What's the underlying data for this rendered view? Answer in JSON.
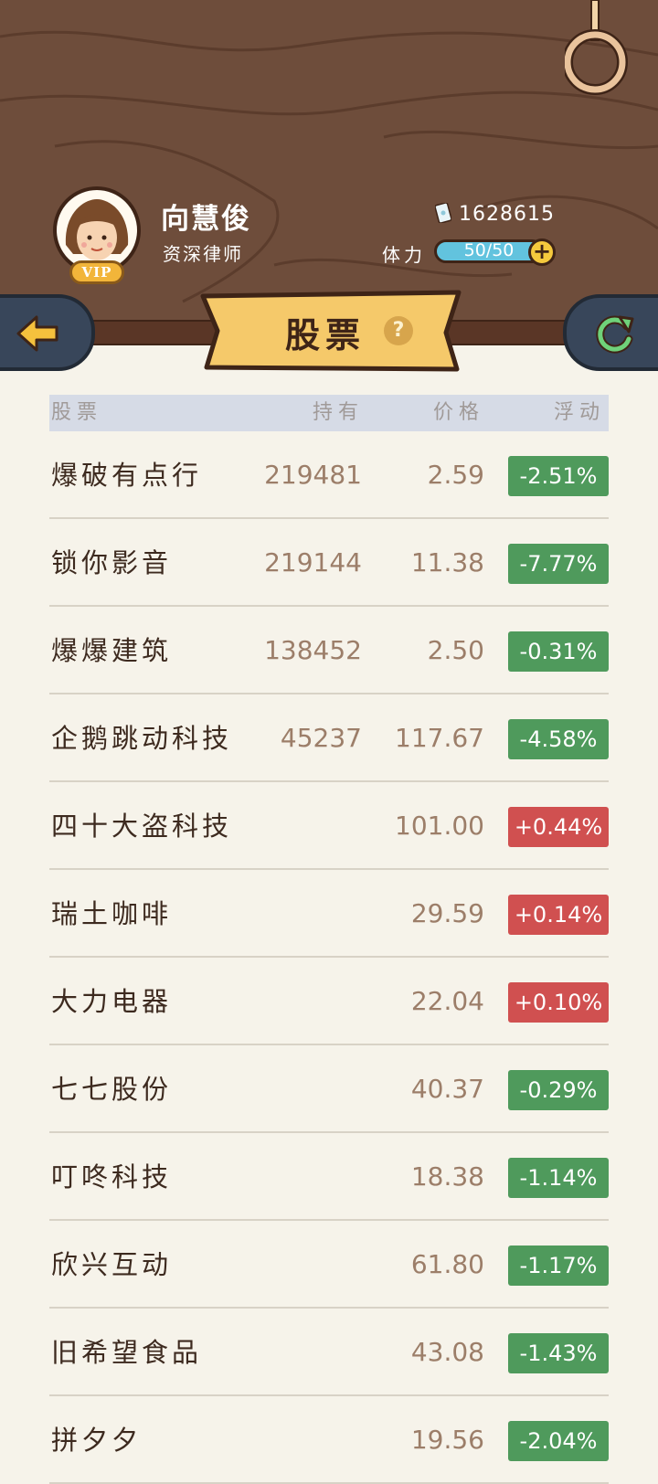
{
  "player": {
    "name": "向慧俊",
    "title": "资深律师",
    "vip": "VIP",
    "money": "1628615",
    "stamina_label": "体力",
    "stamina": "50/50",
    "stamina_fraction": 1.0
  },
  "page": {
    "title": "股票"
  },
  "table": {
    "headers": {
      "stock": "股票",
      "hold": "持有",
      "price": "价格",
      "change": "浮动"
    },
    "rows": [
      {
        "name": "爆破有点行",
        "hold": "219481",
        "price": "2.59",
        "change": "-2.51%",
        "dir": "down"
      },
      {
        "name": "锁你影音",
        "hold": "219144",
        "price": "11.38",
        "change": "-7.77%",
        "dir": "down"
      },
      {
        "name": "爆爆建筑",
        "hold": "138452",
        "price": "2.50",
        "change": "-0.31%",
        "dir": "down"
      },
      {
        "name": "企鹅跳动科技",
        "hold": "45237",
        "price": "117.67",
        "change": "-4.58%",
        "dir": "down"
      },
      {
        "name": "四十大盗科技",
        "hold": "",
        "price": "101.00",
        "change": "+0.44%",
        "dir": "up"
      },
      {
        "name": "瑞土咖啡",
        "hold": "",
        "price": "29.59",
        "change": "+0.14%",
        "dir": "up"
      },
      {
        "name": "大力电器",
        "hold": "",
        "price": "22.04",
        "change": "+0.10%",
        "dir": "up"
      },
      {
        "name": "七七股份",
        "hold": "",
        "price": "40.37",
        "change": "-0.29%",
        "dir": "down"
      },
      {
        "name": "叮咚科技",
        "hold": "",
        "price": "18.38",
        "change": "-1.14%",
        "dir": "down"
      },
      {
        "name": "欣兴互动",
        "hold": "",
        "price": "61.80",
        "change": "-1.17%",
        "dir": "down"
      },
      {
        "name": "旧希望食品",
        "hold": "",
        "price": "43.08",
        "change": "-1.43%",
        "dir": "down"
      },
      {
        "name": "拼夕夕",
        "hold": "",
        "price": "19.56",
        "change": "-2.04%",
        "dir": "down"
      }
    ]
  },
  "colors": {
    "wood": "#6e4d3b",
    "up": "#d05050",
    "down": "#4f9a5c",
    "banner": "#f5c96a"
  },
  "icons": {
    "back": "arrow-left-icon",
    "refresh": "refresh-icon",
    "help": "question-icon",
    "money": "banknote-icon",
    "plus": "plus-icon"
  }
}
